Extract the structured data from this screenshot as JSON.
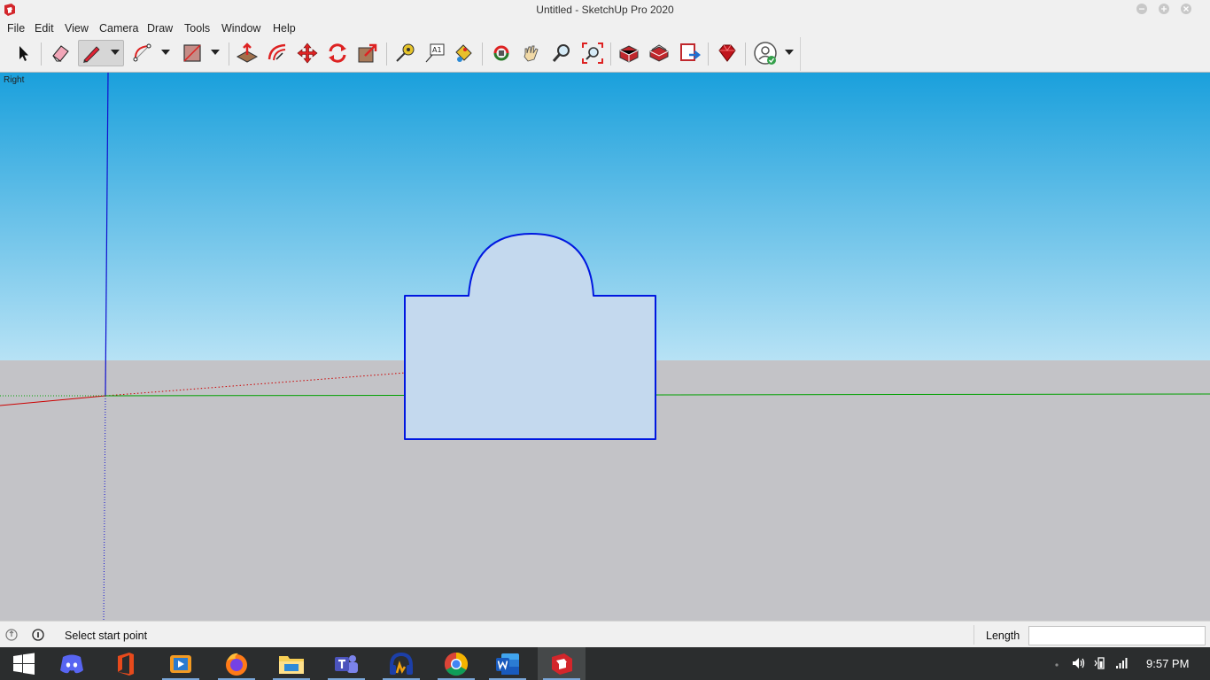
{
  "window": {
    "title": "Untitled - SketchUp Pro 2020"
  },
  "menu": [
    "File",
    "Edit",
    "View",
    "Camera",
    "Draw",
    "Tools",
    "Window",
    "Help"
  ],
  "toolbar": {
    "tools": [
      "select-icon",
      "eraser-icon",
      "line-pencil-icon",
      "arc-icon",
      "rectangle-icon",
      "push-pull-icon",
      "offset-icon",
      "move-icon",
      "rotate-icon",
      "scale-icon",
      "tape-measure-icon",
      "text-icon",
      "paint-bucket-icon",
      "orbit-icon",
      "pan-icon",
      "zoom-icon",
      "zoom-extents-icon",
      "warehouse-icon",
      "extension-warehouse-icon",
      "send-to-layout-icon",
      "ruby-console-icon",
      "account-icon"
    ],
    "active_tool": "line-pencil-icon"
  },
  "viewport": {
    "view_label": "Right",
    "colors": {
      "sky_top": "#1aa0dc",
      "sky_bottom": "#b7e2f5",
      "ground": "#c3c3c7",
      "shape_fill": "#c4d9ee",
      "shape_edge": "#0018e0",
      "x_axis": "#cc0000",
      "y_axis": "#00a000",
      "z_axis": "#0000cc"
    }
  },
  "status": {
    "message": "Select start point",
    "length_label": "Length",
    "length_value": ""
  },
  "taskbar": {
    "apps": [
      "windows-start-icon",
      "discord-icon",
      "office-icon",
      "video-player-icon",
      "firefox-icon",
      "file-explorer-icon",
      "teams-icon",
      "audio-app-icon",
      "chrome-icon",
      "word-icon",
      "sketchup-icon"
    ],
    "clock": "9:57 PM"
  }
}
